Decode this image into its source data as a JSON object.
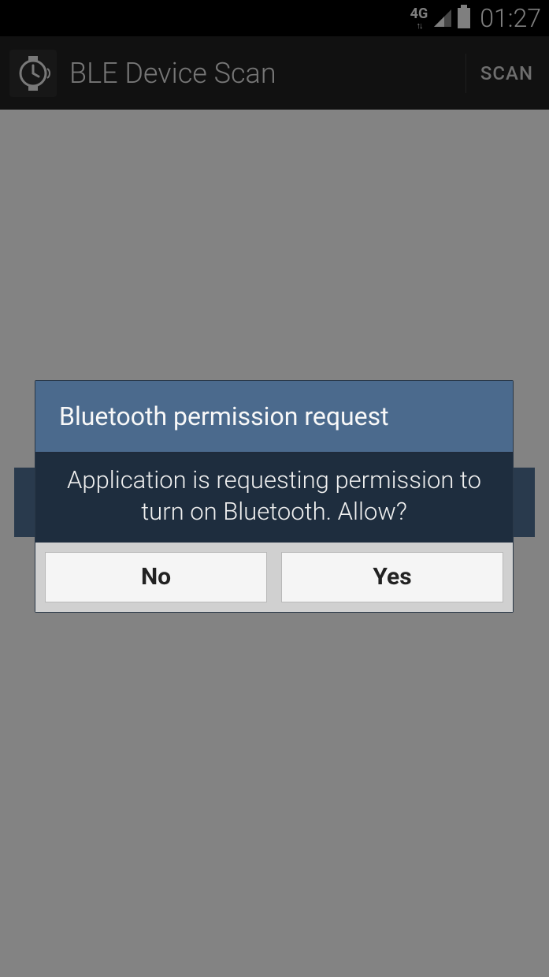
{
  "status_bar": {
    "network_label": "4G",
    "time": "01:27"
  },
  "action_bar": {
    "title": "BLE Device Scan",
    "scan_label": "SCAN"
  },
  "dialog": {
    "title": "Bluetooth permission request",
    "message": "Application is requesting permission to turn on Bluetooth. Allow?",
    "no_label": "No",
    "yes_label": "Yes"
  }
}
